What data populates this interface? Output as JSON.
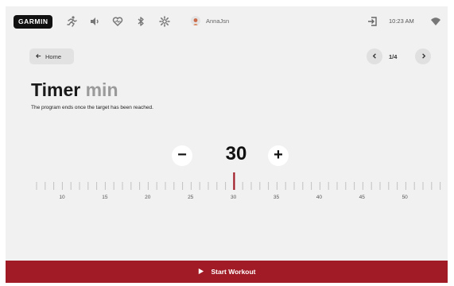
{
  "status_bar": {
    "logo": "GARMIN",
    "user_name": "AnnaJsn",
    "time": "10:23 AM",
    "icons": [
      "running-icon",
      "volume-icon",
      "heart-rate-icon",
      "bluetooth-icon",
      "settings-icon",
      "avatar",
      "exit-icon",
      "wifi-icon"
    ]
  },
  "nav": {
    "home_label": "Home",
    "page_indicator": "1/4"
  },
  "title": {
    "main": "Timer",
    "unit": "min",
    "subtitle": "The program ends once the target has been reached."
  },
  "stepper": {
    "value": "30",
    "minus_label": "−",
    "plus_label": "+",
    "ruler_labels": [
      "10",
      "15",
      "20",
      "25",
      "30",
      "35",
      "40",
      "45",
      "50"
    ]
  },
  "footer": {
    "start_label": "Start Workout"
  },
  "colors": {
    "accent": "#a11b26",
    "background": "#f1f1f1"
  }
}
